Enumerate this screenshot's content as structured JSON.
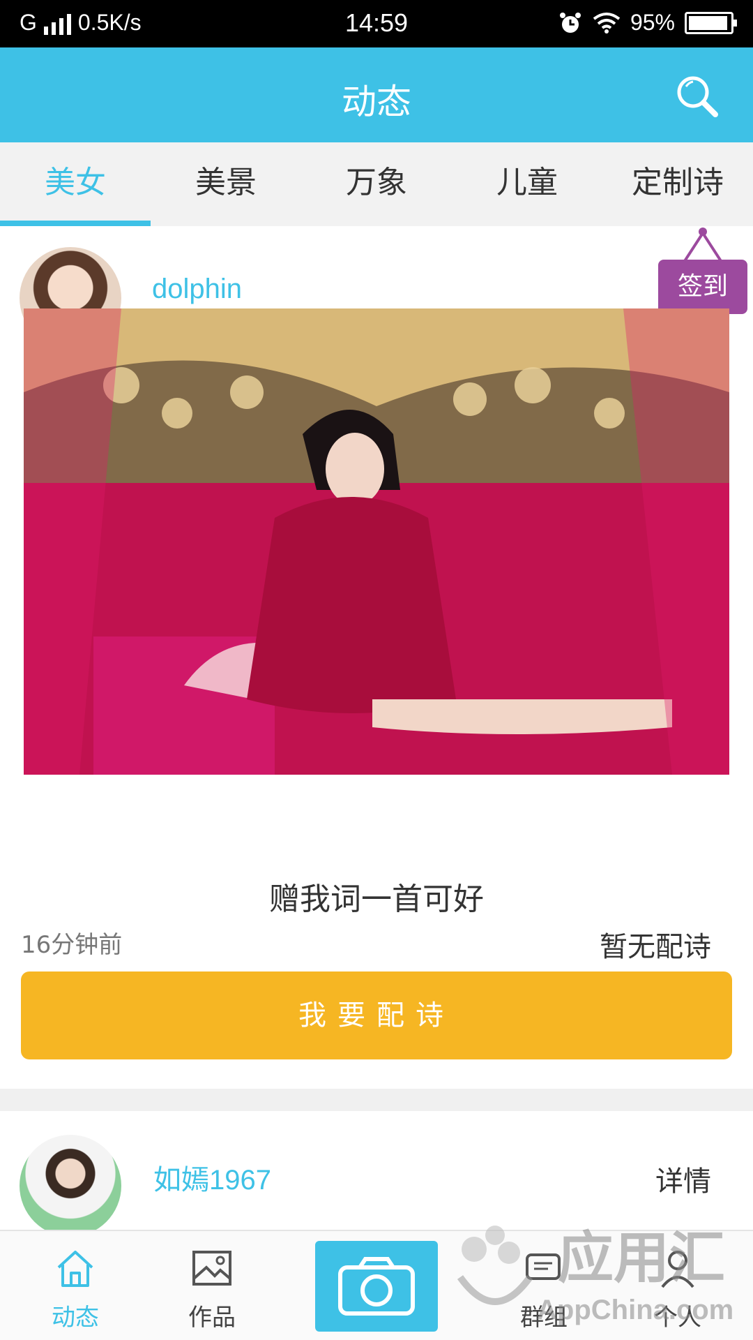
{
  "status_bar": {
    "network": "G",
    "speed": "0.5K/s",
    "time": "14:59",
    "battery": "95%",
    "battery_level": 0.95
  },
  "app_bar": {
    "title": "动态",
    "search_icon": "search-icon"
  },
  "tabs": [
    {
      "label": "美女",
      "active": true
    },
    {
      "label": "美景",
      "active": false
    },
    {
      "label": "万象",
      "active": false
    },
    {
      "label": "儿童",
      "active": false
    },
    {
      "label": "定制诗",
      "active": false
    }
  ],
  "posts": [
    {
      "username": "dolphin",
      "sign_in_label": "签到",
      "caption": "赠我词一首可好",
      "time_ago": "16分钟前",
      "poem_status": "暂无配诗",
      "action_label": "我要配诗"
    },
    {
      "username": "如嫣1967",
      "details_label": "详情"
    }
  ],
  "bottom_nav": {
    "items": [
      {
        "label": "动态",
        "icon": "home-icon",
        "active": true
      },
      {
        "label": "作品",
        "icon": "image-icon",
        "active": false
      },
      {
        "label": "",
        "icon": "camera-icon",
        "active": false
      },
      {
        "label": "群组",
        "icon": "chat-icon",
        "active": false
      },
      {
        "label": "个人",
        "icon": "person-icon",
        "active": false
      }
    ]
  },
  "watermark": {
    "text_main": "应用汇",
    "text_sub": "AppChina.com"
  },
  "colors": {
    "accent": "#3ec1e6",
    "button": "#f6b623",
    "signin": "#9c4a9e"
  }
}
